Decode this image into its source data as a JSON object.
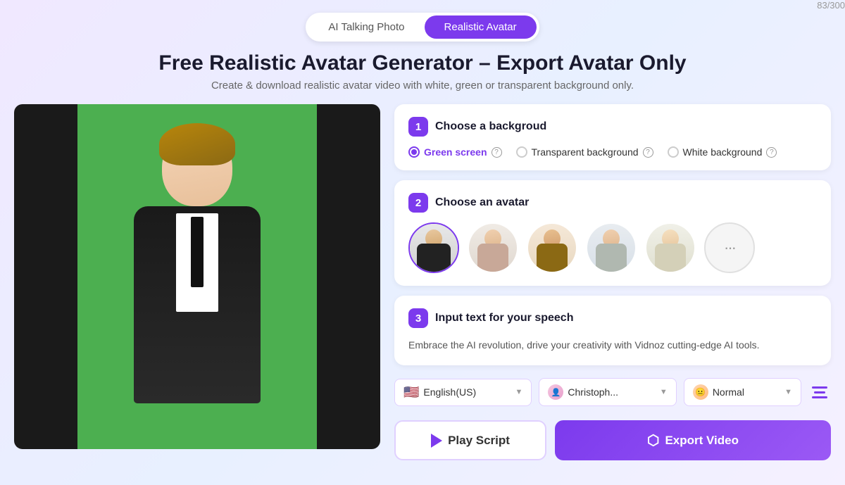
{
  "tabs": {
    "items": [
      {
        "id": "ai-talking-photo",
        "label": "AI Talking Photo",
        "active": false
      },
      {
        "id": "realistic-avatar",
        "label": "Realistic Avatar",
        "active": true
      }
    ]
  },
  "hero": {
    "title": "Free Realistic Avatar Generator – Export Avatar Only",
    "subtitle": "Create & download realistic avatar video with white, green or transparent background only."
  },
  "steps": {
    "step1": {
      "number": "1",
      "title": "Choose a backgroud",
      "options": [
        {
          "id": "green-screen",
          "label": "Green screen",
          "selected": true
        },
        {
          "id": "transparent",
          "label": "Transparent background",
          "selected": false
        },
        {
          "id": "white",
          "label": "White background",
          "selected": false
        }
      ]
    },
    "step2": {
      "number": "2",
      "title": "Choose an avatar",
      "avatars": [
        {
          "id": "av1",
          "label": "Avatar 1",
          "selected": true
        },
        {
          "id": "av2",
          "label": "Avatar 2",
          "selected": false
        },
        {
          "id": "av3",
          "label": "Avatar 3",
          "selected": false
        },
        {
          "id": "av4",
          "label": "Avatar 4",
          "selected": false
        },
        {
          "id": "av5",
          "label": "Avatar 5",
          "selected": false
        }
      ],
      "more_label": "···"
    },
    "step3": {
      "number": "3",
      "title": "Input text for your speech",
      "counter": "83/300",
      "text": "Embrace the AI revolution, drive your creativity with Vidnoz cutting-edge AI tools."
    }
  },
  "controls": {
    "language": {
      "value": "English(US)",
      "flag": "🇺🇸"
    },
    "voice": {
      "value": "Christoph...",
      "icon": "voice-icon"
    },
    "speed": {
      "value": "Normal",
      "icon": "speed-icon"
    }
  },
  "buttons": {
    "play_label": "Play Script",
    "export_label": "Export Video"
  }
}
